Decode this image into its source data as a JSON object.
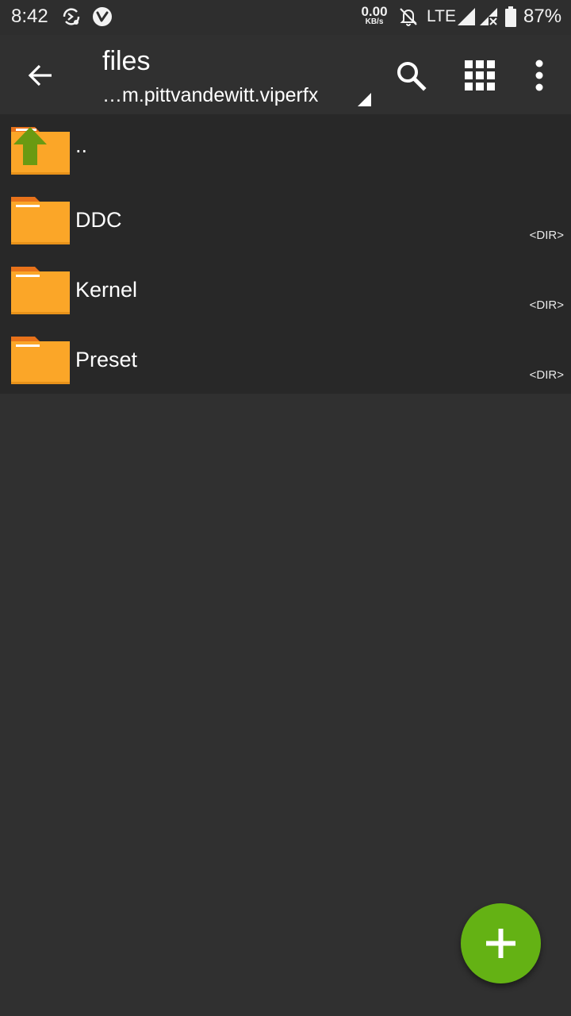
{
  "status_bar": {
    "time": "8:42",
    "net_speed_value": "0.00",
    "net_speed_unit": "KB/s",
    "network": "LTE",
    "battery": "87%",
    "icons": [
      "sync-icon",
      "vivaldi-icon",
      "notifications-off-icon",
      "signal-icon",
      "signal-no-data-icon",
      "battery-icon"
    ]
  },
  "toolbar": {
    "title": "files",
    "path": "…m.pittvandewitt.viperfx",
    "back_icon": "arrow-back-icon",
    "search_icon": "search-icon",
    "view_icon": "grid-view-icon",
    "more_icon": "more-vert-icon"
  },
  "files": {
    "parent": {
      "label": ".."
    },
    "items": [
      {
        "name": "DDC",
        "type": "<DIR>"
      },
      {
        "name": "Kernel",
        "type": "<DIR>"
      },
      {
        "name": "Preset",
        "type": "<DIR>"
      }
    ]
  },
  "fab": {
    "icon": "add-icon"
  },
  "colors": {
    "background": "#303030",
    "list_background": "#282828",
    "folder": "#fba628",
    "folder_tab": "#e8721a",
    "up_arrow": "#6a9a12",
    "fab": "#64b214"
  }
}
